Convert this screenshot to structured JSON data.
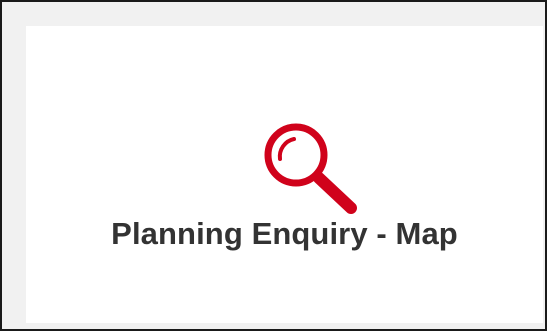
{
  "tile": {
    "label": "Planning Enquiry - Map",
    "icon": "search-icon",
    "icon_color": "#d0021b",
    "label_color": "#333333"
  }
}
